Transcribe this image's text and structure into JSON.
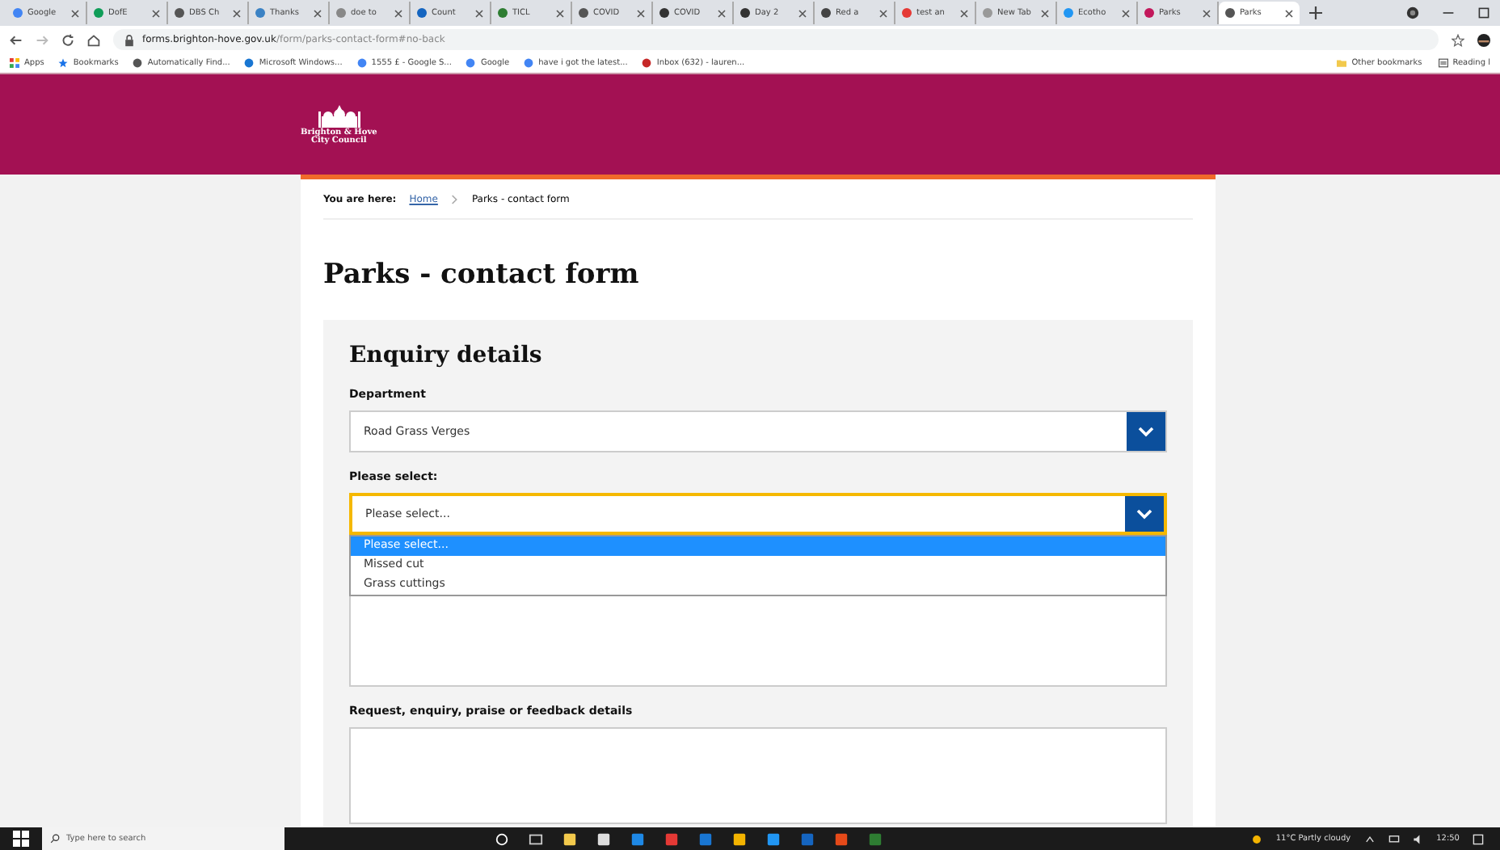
{
  "browser": {
    "tabs": [
      {
        "label": "Google",
        "selected": false
      },
      {
        "label": "DofE",
        "selected": false
      },
      {
        "label": "DBS Ch",
        "selected": false
      },
      {
        "label": "Thanks",
        "selected": false
      },
      {
        "label": "doe to",
        "selected": false
      },
      {
        "label": "Count",
        "selected": false
      },
      {
        "label": "TICL",
        "selected": false
      },
      {
        "label": "COVID",
        "selected": false
      },
      {
        "label": "COVID",
        "selected": false
      },
      {
        "label": "Day 2",
        "selected": false
      },
      {
        "label": "Red a",
        "selected": false
      },
      {
        "label": "test an",
        "selected": false
      },
      {
        "label": "New Tab",
        "selected": false
      },
      {
        "label": "Ecotho",
        "selected": false
      },
      {
        "label": "Parks",
        "selected": false
      },
      {
        "label": "Parks",
        "selected": true
      }
    ],
    "address_host": "forms.brighton-hove.gov.uk",
    "address_path": "/form/parks-contact-form#no-back",
    "bookmarks": [
      "Apps",
      "Bookmarks",
      "Automatically Find...",
      "Microsoft Windows...",
      "1555 £ - Google S...",
      "Google",
      "have i got the latest...",
      "Inbox (632) - lauren..."
    ],
    "other_bookmarks": "Other bookmarks",
    "reading_list": "Reading l"
  },
  "site": {
    "logo_lines": [
      "Brighton & Hove",
      "City Council"
    ]
  },
  "breadcrumb": {
    "label": "You are here:",
    "link": "Home",
    "current": "Parks - contact form"
  },
  "title": "Parks - contact form",
  "form": {
    "heading": "Enquiry details",
    "fields": [
      {
        "kind": "select",
        "label": "Department",
        "value": "Road Grass Verges",
        "focused": false
      },
      {
        "kind": "select",
        "label": "Please select:",
        "value": "Please select...",
        "focused": true,
        "options": [
          {
            "label": "Please select...",
            "selected": true
          },
          {
            "label": "Missed cut",
            "selected": false
          },
          {
            "label": "Grass cuttings",
            "selected": false
          }
        ]
      },
      {
        "kind": "textarea"
      },
      {
        "kind": "textarea",
        "label": "Request, enquiry, praise or feedback details"
      }
    ]
  },
  "taskbar": {
    "search_placeholder": "Type here to search",
    "weather": "11°C Partly cloudy",
    "time": "12:50"
  }
}
